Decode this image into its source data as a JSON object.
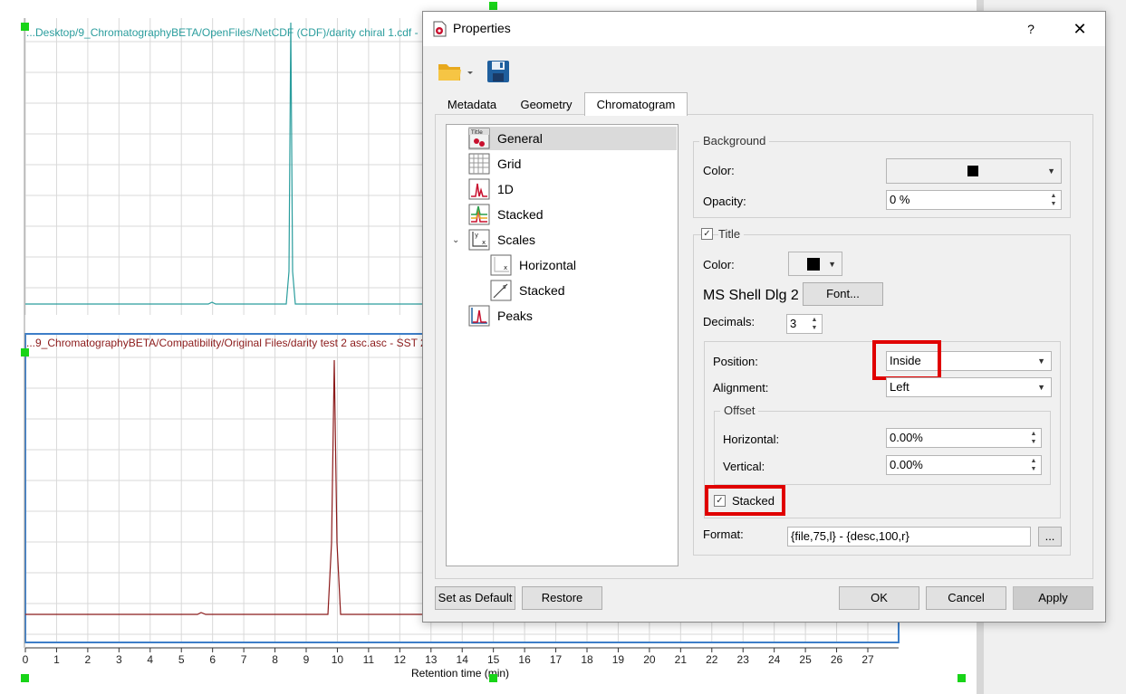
{
  "chart": {
    "top_file_label": "...Desktop/9_ChromatographyBETA/OpenFiles/NetCDF (CDF)/darity chiral 1.cdf -",
    "bottom_file_label": "...9_ChromatographyBETA/Compatibility/Original Files/darity test 2 asc.asc - SST 2",
    "x_axis_title": "Retention time (min)",
    "x_ticks": [
      "0",
      "1",
      "2",
      "3",
      "4",
      "5",
      "6",
      "7",
      "8",
      "9",
      "10",
      "11",
      "12",
      "13",
      "14",
      "15",
      "16",
      "17",
      "18",
      "19",
      "20",
      "21",
      "22",
      "23",
      "24",
      "25",
      "26",
      "27"
    ],
    "top_trace_color": "#2a9d9d",
    "bottom_trace_color": "#8b1a1a"
  },
  "dialog": {
    "title": "Properties",
    "help": "?",
    "close": "✕",
    "tabs": [
      {
        "label": "Metadata"
      },
      {
        "label": "Geometry"
      },
      {
        "label": "Chromatogram"
      }
    ],
    "tree": [
      {
        "label": "General",
        "icon": "title-icon"
      },
      {
        "label": "Grid",
        "icon": "grid-icon"
      },
      {
        "label": "1D",
        "icon": "1d-icon"
      },
      {
        "label": "Stacked",
        "icon": "stacked-icon"
      },
      {
        "label": "Scales",
        "icon": "scales-icon"
      },
      {
        "label": "Horizontal",
        "icon": "horizontal-scale-icon"
      },
      {
        "label": "Stacked",
        "icon": "stacked-scale-icon"
      },
      {
        "label": "Peaks",
        "icon": "peaks-icon"
      }
    ],
    "background": {
      "group_label": "Background",
      "color_label": "Color:",
      "opacity_label": "Opacity:",
      "opacity_value": "0 %"
    },
    "title_group": {
      "group_label": "Title",
      "color_label": "Color:",
      "font_name": "MS Shell Dlg 2",
      "font_button": "Font...",
      "decimals_label": "Decimals:",
      "decimals_value": "3",
      "position_label": "Position:",
      "position_value": "Inside",
      "alignment_label": "Alignment:",
      "alignment_value": "Left",
      "offset_label": "Offset",
      "horizontal_label": "Horizontal:",
      "horizontal_value": "0.00%",
      "vertical_label": "Vertical:",
      "vertical_value": "0.00%",
      "stacked_label": "Stacked",
      "format_label": "Format:",
      "format_value": "{file,75,l} - {desc,100,r}",
      "format_more": "..."
    },
    "buttons": {
      "set_default": "Set as Default",
      "restore": "Restore",
      "ok": "OK",
      "cancel": "Cancel",
      "apply": "Apply"
    }
  }
}
